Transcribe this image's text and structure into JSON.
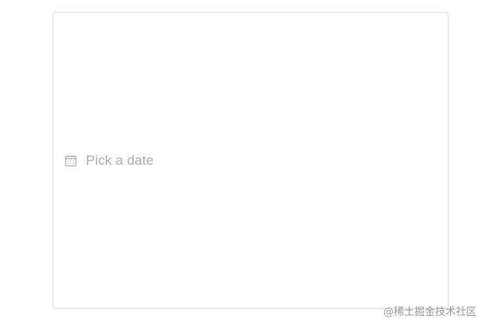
{
  "date_picker": {
    "placeholder": "Pick a date",
    "icon": "calendar-icon"
  },
  "watermark": {
    "text": "@稀土掘金技术社区"
  },
  "colors": {
    "border": "#dcdfe6",
    "placeholder_text": "#a8abb2",
    "icon": "#a8abb2"
  }
}
